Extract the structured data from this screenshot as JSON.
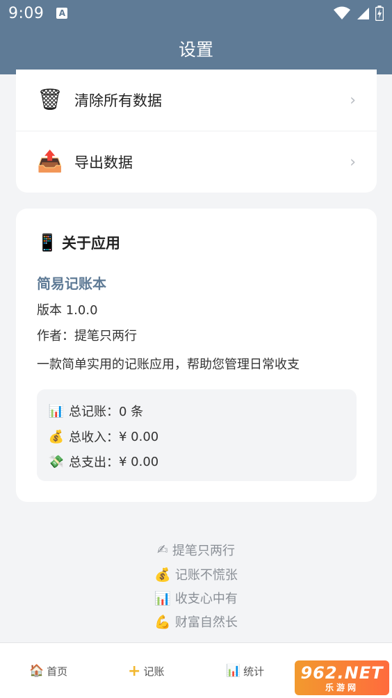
{
  "status_bar": {
    "time": "9:09",
    "notif_letter": "A"
  },
  "app": {
    "title": "设置"
  },
  "actions": [
    {
      "label": "清除所有数据",
      "icon": "trash-icon",
      "chevron": "›"
    },
    {
      "label": "导出数据",
      "icon": "export-tray-icon",
      "chevron": "›"
    }
  ],
  "about": {
    "heading": "关于应用",
    "app_name": "简易记账本",
    "version": "版本 1.0.0",
    "author": "作者：提笔只两行",
    "description": "一款简单实用的记账应用，帮助您管理日常收支",
    "stats": [
      {
        "icon": "bar-chart-icon",
        "label": "总记账：",
        "value": "0 条"
      },
      {
        "icon": "money-bag-icon",
        "label": "总收入：",
        "value": "¥ 0.00"
      },
      {
        "icon": "flying-money-icon",
        "label": "总支出：",
        "value": "¥ 0.00"
      }
    ]
  },
  "slogans": [
    {
      "icon": "writing-hand-icon",
      "text": "提笔只两行"
    },
    {
      "icon": "money-bag-icon",
      "text": "记账不慌张"
    },
    {
      "icon": "bar-chart-icon",
      "text": "收支心中有"
    },
    {
      "icon": "flexed-biceps-icon",
      "text": "财富自然长"
    }
  ],
  "tabs": [
    {
      "label": "首页",
      "icon": "house-icon"
    },
    {
      "label": "记账",
      "icon": "plus-icon"
    },
    {
      "label": "统计",
      "icon": "bar-chart-icon"
    }
  ],
  "watermark": {
    "line1": "962.NET",
    "line2": "乐游网"
  },
  "colors": {
    "primary": "#5f7b96",
    "background": "#f3f4f6",
    "card": "#ffffff"
  }
}
